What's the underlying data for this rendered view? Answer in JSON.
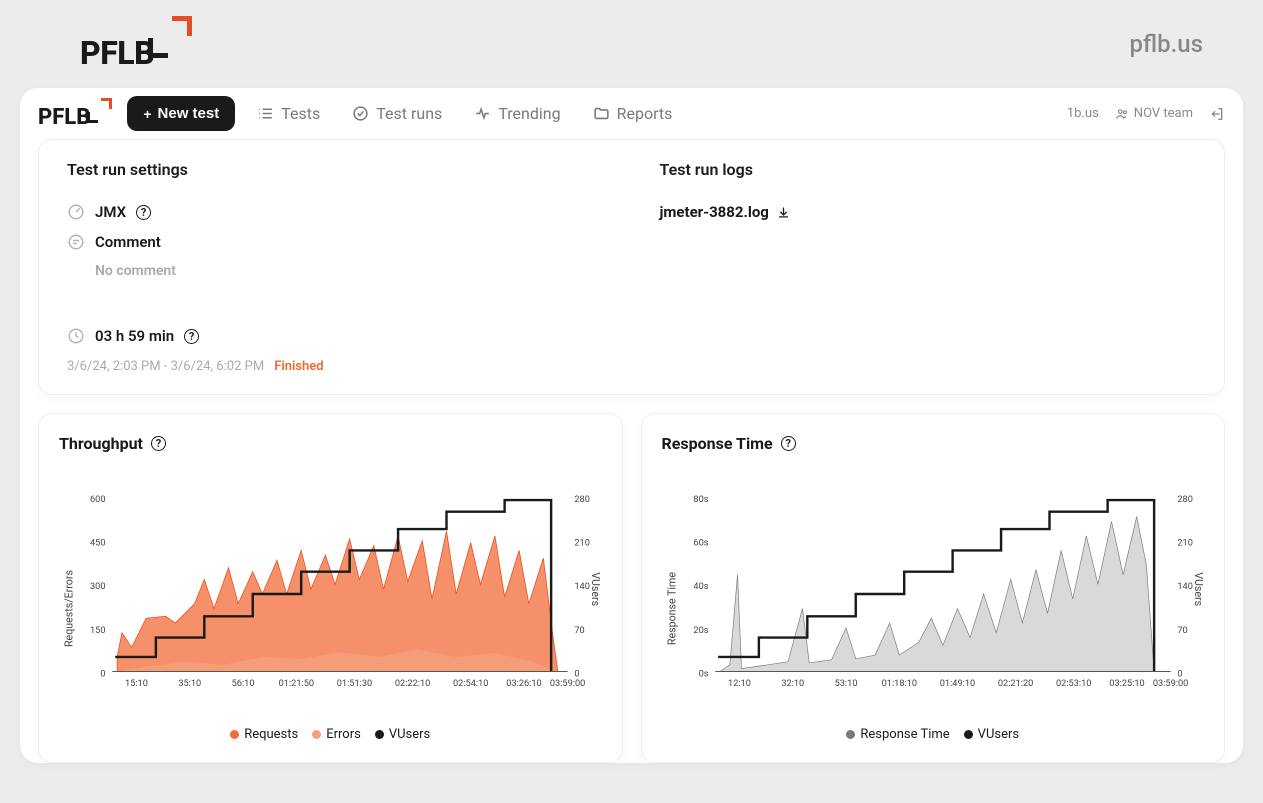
{
  "top_brand": {
    "logo_text": "PFLB",
    "link_text": "pflb.us"
  },
  "app_header": {
    "logo_text": "PFLB",
    "new_test_label": "New test",
    "nav": [
      {
        "label": "Tests"
      },
      {
        "label": "Test runs"
      },
      {
        "label": "Trending"
      },
      {
        "label": "Reports"
      }
    ],
    "domain_label": "1b.us",
    "team_label": "NOV team"
  },
  "settings": {
    "title": "Test run settings",
    "jmx_label": "JMX",
    "comment_label": "Comment",
    "comment_value": "No comment",
    "duration_text": "03 h 59 min",
    "timestamp_range": "3/6/24, 2:03 PM - 3/6/24, 6:02 PM",
    "status_text": "Finished"
  },
  "logs": {
    "title": "Test run logs",
    "log_file": "jmeter-3882.log"
  },
  "charts": {
    "throughput": {
      "title": "Throughput",
      "left_axis_label": "Requests/Errors",
      "right_axis_label": "VUsers",
      "legend": [
        "Requests",
        "Errors",
        "VUsers"
      ],
      "colors": {
        "requests": "#f26b3a",
        "errors": "#f5a07a",
        "vusers": "#1a1a1a"
      }
    },
    "response_time": {
      "title": "Response Time",
      "left_axis_label": "Response Time",
      "right_axis_label": "VUsers",
      "legend": [
        "Response Time",
        "VUsers"
      ],
      "colors": {
        "response_time": "#9e9e9e",
        "vusers": "#1a1a1a"
      }
    }
  },
  "chart_data": [
    {
      "id": "throughput",
      "type": "line",
      "x_ticks": [
        "15:10",
        "35:10",
        "56:10",
        "01:21:50",
        "01:51:30",
        "02:22:10",
        "02:54:10",
        "03:26:10",
        "03:59:00"
      ],
      "left_y": {
        "ticks": [
          0,
          150,
          300,
          450,
          600
        ],
        "range": [
          0,
          600
        ]
      },
      "right_y": {
        "ticks": [
          0,
          70,
          140,
          210,
          280
        ],
        "range": [
          0,
          280
        ]
      },
      "series": [
        {
          "name": "Requests",
          "axis": "left",
          "color": "#f26b3a",
          "values": [
            80,
            150,
            220,
            220,
            300,
            320,
            350,
            300,
            280
          ]
        },
        {
          "name": "Errors",
          "axis": "left",
          "color": "#f5a07a",
          "values": [
            10,
            20,
            40,
            30,
            60,
            50,
            80,
            60,
            40
          ]
        },
        {
          "name": "VUsers",
          "axis": "right",
          "color": "#1a1a1a",
          "values": [
            35,
            35,
            70,
            70,
            105,
            140,
            175,
            210,
            245,
            280,
            280,
            0
          ],
          "style": "step"
        }
      ]
    },
    {
      "id": "response_time",
      "type": "line",
      "x_ticks": [
        "12:10",
        "32:10",
        "53:10",
        "01:18:10",
        "01:49:10",
        "02:21:20",
        "02:53:10",
        "03:25:10",
        "03:59:00"
      ],
      "left_y": {
        "ticks": [
          "0s",
          "20s",
          "40s",
          "60s",
          "80s"
        ],
        "range": [
          0,
          80
        ]
      },
      "right_y": {
        "ticks": [
          0,
          70,
          140,
          210,
          280
        ],
        "range": [
          0,
          280
        ]
      },
      "series": [
        {
          "name": "Response Time",
          "axis": "left",
          "color": "#9e9e9e",
          "values": [
            5,
            8,
            10,
            12,
            18,
            25,
            35,
            50,
            60
          ]
        },
        {
          "name": "VUsers",
          "axis": "right",
          "color": "#1a1a1a",
          "values": [
            35,
            35,
            70,
            70,
            105,
            140,
            175,
            210,
            245,
            280,
            280,
            0
          ],
          "style": "step"
        }
      ]
    }
  ]
}
